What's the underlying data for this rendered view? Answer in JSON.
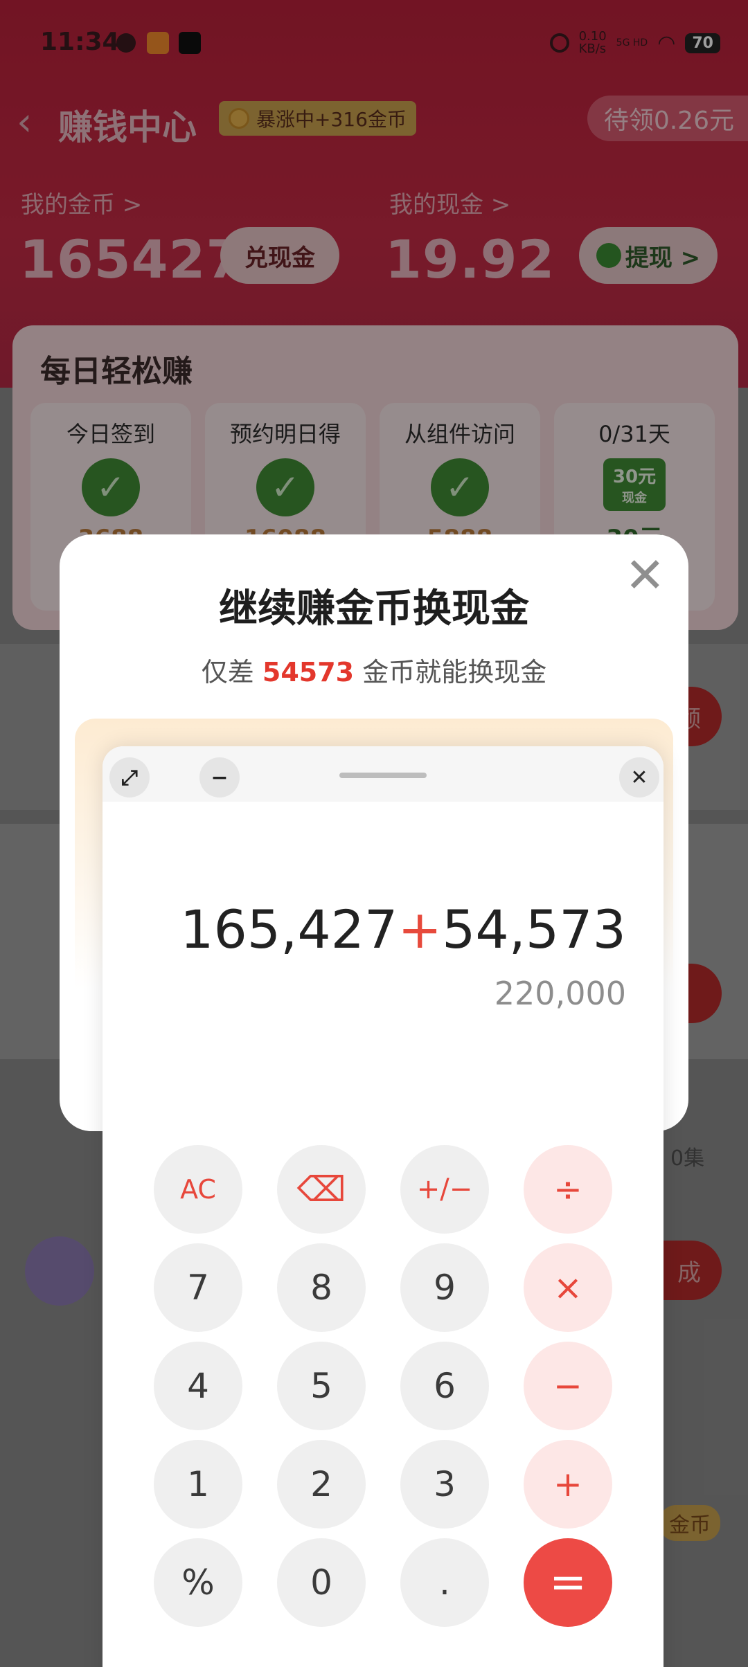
{
  "status_bar": {
    "time": "11:34",
    "net_speed": "0.10",
    "net_unit": "KB/s",
    "network": "5G HD",
    "battery": "70"
  },
  "nav": {
    "title": "赚钱中心",
    "badge": "暴涨中+316金币",
    "pending": "待领0.26元"
  },
  "stats": {
    "coins_label": "我的金币 >",
    "coins_value": "165427",
    "exchange_btn": "兑现金",
    "cash_label": "我的现金 >",
    "cash_value": "19.92",
    "withdraw_btn": "提现 >"
  },
  "daily": {
    "heading": "每日轻松赚",
    "tasks": [
      {
        "label": "今日签到",
        "amount": "3688"
      },
      {
        "label": "预约明日得",
        "amount": "16088"
      },
      {
        "label": "从组件访问",
        "amount": "5888"
      },
      {
        "label": "0/31天",
        "amount": "30元",
        "tag": "30元",
        "tag_sub": "现金"
      }
    ]
  },
  "background_fragments": {
    "pill_1": "领",
    "text_1": "0集",
    "pill_2": "成",
    "coin_text": "金币"
  },
  "modal": {
    "title": "继续赚金币换现金",
    "subtitle_prefix": "仅差",
    "subtitle_amount": "54573",
    "subtitle_suffix": "金币就能换现金",
    "close_symbol": "✕"
  },
  "calculator": {
    "expression_a": "165,427",
    "expression_op": "+",
    "expression_b": "54,573",
    "result": "220,000",
    "keys": [
      [
        "AC",
        "⌫",
        "+/−",
        "÷"
      ],
      [
        "7",
        "8",
        "9",
        "×"
      ],
      [
        "4",
        "5",
        "6",
        "−"
      ],
      [
        "1",
        "2",
        "3",
        "+"
      ],
      [
        "%",
        "0",
        ".",
        "="
      ]
    ]
  }
}
